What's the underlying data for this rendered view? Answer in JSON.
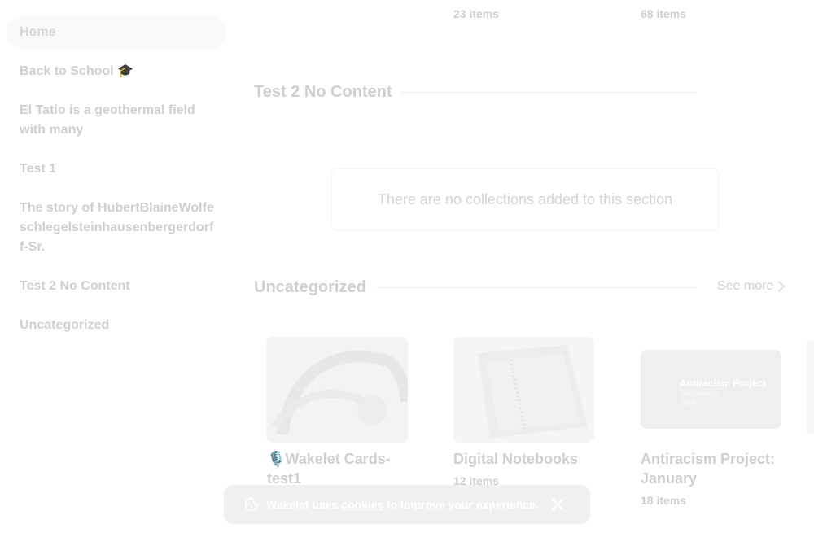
{
  "sidebar": {
    "items": [
      {
        "label": "Home"
      },
      {
        "label": "Back to School 🎓"
      },
      {
        "label": "El Tatio is a geothermal field with many"
      },
      {
        "label": "Test 1"
      },
      {
        "label": "The story of HubertBlaineWolfeschlegelsteinhausenbergerdorff-Sr."
      },
      {
        "label": "Test 2 No Content"
      },
      {
        "label": "Uncategorized"
      }
    ]
  },
  "top_counts": [
    "23 items",
    "68 items"
  ],
  "sections": {
    "test2": {
      "title": "Test 2 No Content",
      "empty_message": "There are no collections added to this section"
    },
    "uncategorized": {
      "title": "Uncategorized",
      "see_more": "See more",
      "cards": [
        {
          "title": "🎙️Wakelet Cards-test1",
          "count": ""
        },
        {
          "title": "Digital Notebooks",
          "count": "12 items"
        },
        {
          "title": "Antiracism Project: January",
          "count": "18 items",
          "thumb_title": "Antiracism Project",
          "thumb_subtitle": "Educators for Equity"
        }
      ]
    }
  },
  "cookie_banner": {
    "prefix": "Wakelet uses",
    "link": "cookies",
    "suffix": "to improve your experience."
  },
  "colors": {
    "text_faded": "#cfcfcf",
    "banner_bg": "#f0f0f0"
  }
}
